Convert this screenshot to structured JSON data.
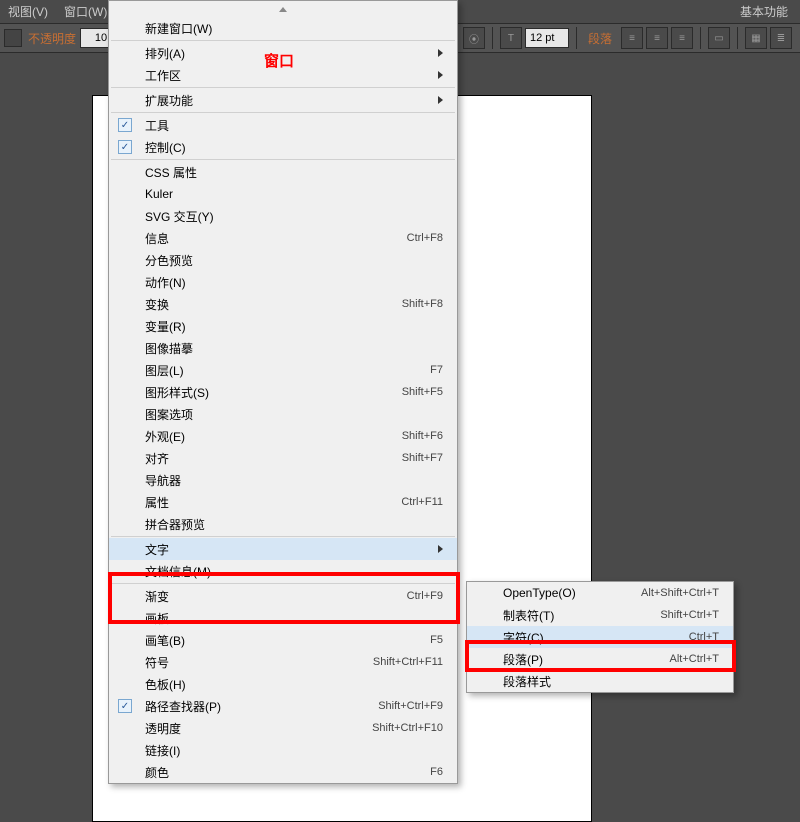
{
  "topbar": {
    "menu_view": "视图(V)",
    "menu_window": "窗口(W)",
    "right_label": "基本功能"
  },
  "toolbar": {
    "opacity_label": "不透明度",
    "opacity_value": "10",
    "pt_value": "12 pt",
    "para_label": "段落"
  },
  "annotation": {
    "window_text": "窗口"
  },
  "menu": {
    "new_window": "新建窗口(W)",
    "arrange": "排列(A)",
    "workspace": "工作区",
    "extensions": "扩展功能",
    "tools": "工具",
    "control": "控制(C)",
    "css_props": "CSS 属性",
    "kuler": "Kuler",
    "svg": "SVG 交互(Y)",
    "info": "信息",
    "info_sc": "Ctrl+F8",
    "sep_preview": "分色预览",
    "actions": "动作(N)",
    "transform": "变换",
    "transform_sc": "Shift+F8",
    "variables": "变量(R)",
    "image_trace": "图像描摹",
    "layers": "图层(L)",
    "layers_sc": "F7",
    "graphic_styles": "图形样式(S)",
    "graphic_styles_sc": "Shift+F5",
    "pattern_options": "图案选项",
    "appearance": "外观(E)",
    "appearance_sc": "Shift+F6",
    "align": "对齐",
    "align_sc": "Shift+F7",
    "navigator": "导航器",
    "attributes": "属性",
    "attributes_sc": "Ctrl+F11",
    "flattener": "拼合器预览",
    "type": "文字",
    "doc_info": "文档信息(M)",
    "gradient": "渐变",
    "gradient_sc": "Ctrl+F9",
    "artboards": "画板",
    "brushes": "画笔(B)",
    "brushes_sc": "F5",
    "symbols": "符号",
    "symbols_sc": "Shift+Ctrl+F11",
    "swatches": "色板(H)",
    "pathfinder": "路径查找器(P)",
    "pathfinder_sc": "Shift+Ctrl+F9",
    "transparency": "透明度",
    "transparency_sc": "Shift+Ctrl+F10",
    "links": "链接(I)",
    "color": "颜色",
    "color_sc": "F6"
  },
  "submenu": {
    "opentype": "OpenType(O)",
    "opentype_sc": "Alt+Shift+Ctrl+T",
    "tabs": "制表符(T)",
    "tabs_sc": "Shift+Ctrl+T",
    "character": "字符(C)",
    "character_sc": "Ctrl+T",
    "paragraph": "段落(P)",
    "paragraph_sc": "Alt+Ctrl+T",
    "para_styles": "段落样式"
  }
}
